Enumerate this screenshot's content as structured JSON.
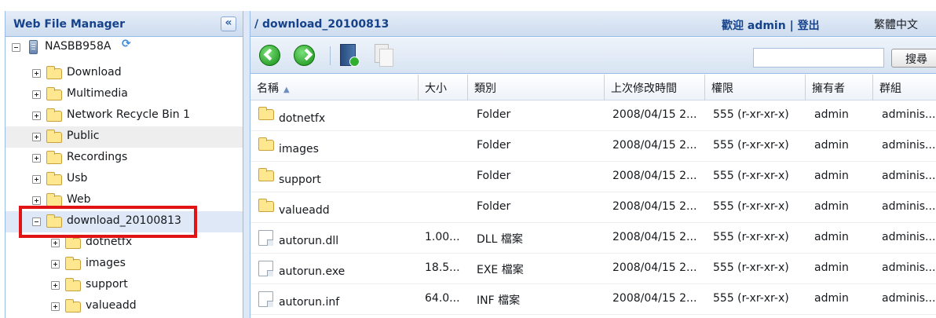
{
  "app_title": "Web File Manager",
  "left_panel": {
    "collapse_label": "«",
    "tree": [
      {
        "label": "NASBB958A",
        "icon": "nas-icon",
        "expander": "minus"
      },
      {
        "label": "Download",
        "icon": "folder-icon",
        "expander": "plus"
      },
      {
        "label": "Multimedia",
        "icon": "folder-icon",
        "expander": "plus"
      },
      {
        "label": "Network Recycle Bin 1",
        "icon": "folder-icon",
        "expander": "plus"
      },
      {
        "label": "Public",
        "icon": "folder-icon",
        "expander": "plus",
        "highlighted": true
      },
      {
        "label": "Recordings",
        "icon": "folder-icon",
        "expander": "plus"
      },
      {
        "label": "Usb",
        "icon": "folder-icon",
        "expander": "plus"
      },
      {
        "label": "Web",
        "icon": "folder-icon",
        "expander": "plus"
      },
      {
        "label": "download_20100813",
        "icon": "share-folder-icon",
        "expander": "minus",
        "selected": true
      },
      {
        "label": "dotnetfx",
        "icon": "folder-icon",
        "expander": "plus"
      },
      {
        "label": "images",
        "icon": "folder-icon",
        "expander": "plus"
      },
      {
        "label": "support",
        "icon": "folder-icon",
        "expander": "plus"
      },
      {
        "label": "valueadd",
        "icon": "folder-icon",
        "expander": "plus"
      }
    ]
  },
  "header": {
    "path": "/ download_20100813",
    "welcome": "歡迎 admin",
    "separator": "|",
    "logout": "登出",
    "language": "繁體中文"
  },
  "toolbar": {
    "search_value": "",
    "search_button": "搜尋"
  },
  "grid": {
    "columns": [
      "名稱",
      "大小",
      "類別",
      "上次修改時間",
      "權限",
      "擁有者",
      "群組"
    ],
    "rows": [
      {
        "name": "dotnetfx",
        "size": "",
        "type": "Folder",
        "modified": "2008/04/15 2...",
        "perm": "555 (r-xr-xr-x)",
        "owner": "admin",
        "group": "adminis...",
        "icon": "folder-icon"
      },
      {
        "name": "images",
        "size": "",
        "type": "Folder",
        "modified": "2008/04/15 2...",
        "perm": "555 (r-xr-xr-x)",
        "owner": "admin",
        "group": "adminis...",
        "icon": "folder-icon"
      },
      {
        "name": "support",
        "size": "",
        "type": "Folder",
        "modified": "2008/04/15 2...",
        "perm": "555 (r-xr-xr-x)",
        "owner": "admin",
        "group": "adminis...",
        "icon": "folder-icon"
      },
      {
        "name": "valueadd",
        "size": "",
        "type": "Folder",
        "modified": "2008/04/15 2...",
        "perm": "555 (r-xr-xr-x)",
        "owner": "admin",
        "group": "adminis...",
        "icon": "folder-icon"
      },
      {
        "name": "autorun.dll",
        "size": "1.00...",
        "type": "DLL 檔案",
        "modified": "2008/04/15 2...",
        "perm": "555 (r-xr-xr-x)",
        "owner": "admin",
        "group": "adminis...",
        "icon": "file-icon"
      },
      {
        "name": "autorun.exe",
        "size": "18.5...",
        "type": "EXE 檔案",
        "modified": "2008/04/15 2...",
        "perm": "555 (r-xr-xr-x)",
        "owner": "admin",
        "group": "adminis...",
        "icon": "file-icon"
      },
      {
        "name": "autorun.inf",
        "size": "64.0...",
        "type": "INF 檔案",
        "modified": "2008/04/15 2...",
        "perm": "555 (r-xr-xr-x)",
        "owner": "admin",
        "group": "adminis...",
        "icon": "file-icon"
      }
    ]
  },
  "colors": {
    "header_text": "#15428b",
    "panel_border": "#99bbe8",
    "selection": "#dfe8f6",
    "highlight_box": "#e01414"
  }
}
